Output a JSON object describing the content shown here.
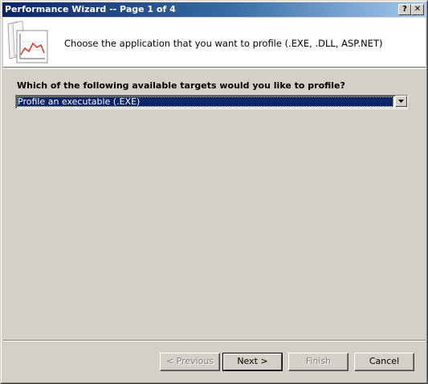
{
  "window": {
    "title": "Performance Wizard -- Page 1 of 4",
    "help_glyph": "?",
    "close_glyph": "✕"
  },
  "header": {
    "title": "Choose the application that you want to profile (.EXE, .DLL, ASP.NET)",
    "icon": "chart-document-icon"
  },
  "main": {
    "question": "Which of the following available targets would you like to profile?",
    "target_select": {
      "selected": "Profile an executable (.EXE)"
    }
  },
  "buttons": {
    "previous": "< Previous",
    "next": "Next >",
    "finish": "Finish",
    "cancel": "Cancel"
  },
  "colors": {
    "title_gradient_start": "#0a246a",
    "title_gradient_end": "#a6caf0",
    "face": "#d4d0c8",
    "selection": "#0a246a"
  }
}
